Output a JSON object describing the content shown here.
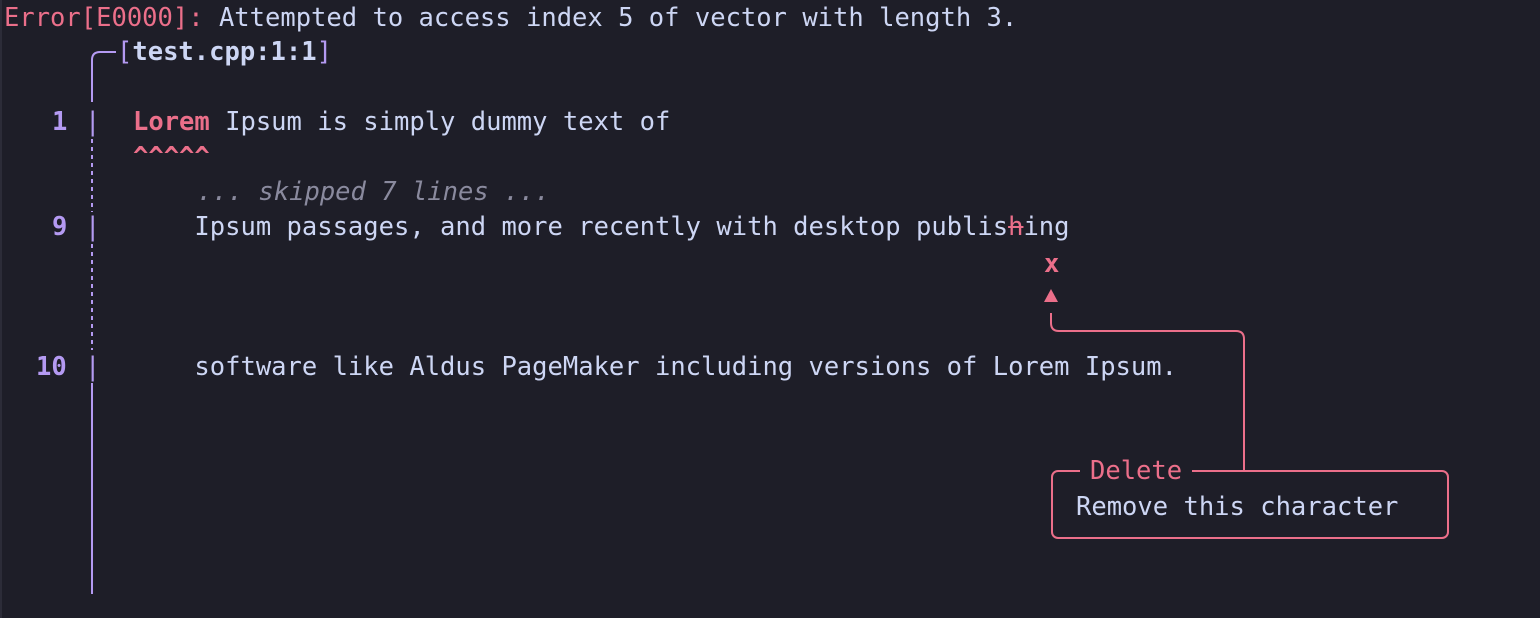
{
  "error": {
    "code": "Error[E0000]:",
    "message": " Attempted to access index 5 of vector with length 3."
  },
  "location": {
    "open_bracket": "[",
    "file": "test.cpp:1:1",
    "close_bracket": "]"
  },
  "lines": [
    {
      "number": "1",
      "highlight": "Lorem",
      "rest": " Ipsum is simply dummy text of",
      "carets": "^^^^^"
    },
    {
      "number": "9",
      "before": "    Ipsum passages, and more recently with desktop publis",
      "struck": "h",
      "after": "ing",
      "mark": "x"
    },
    {
      "number": "10",
      "text": "    software like Aldus PageMaker including versions of Lorem Ipsum."
    }
  ],
  "skipped": "... skipped 7 lines ...",
  "gutter_bar": "|",
  "suggestion": {
    "title": "Delete",
    "body": "Remove this character"
  },
  "colors": {
    "background": "#1e1e28",
    "error": "#eb6f8a",
    "gutter": "#b49af2",
    "text": "#cdd6f4",
    "muted": "#8a8a9e"
  }
}
